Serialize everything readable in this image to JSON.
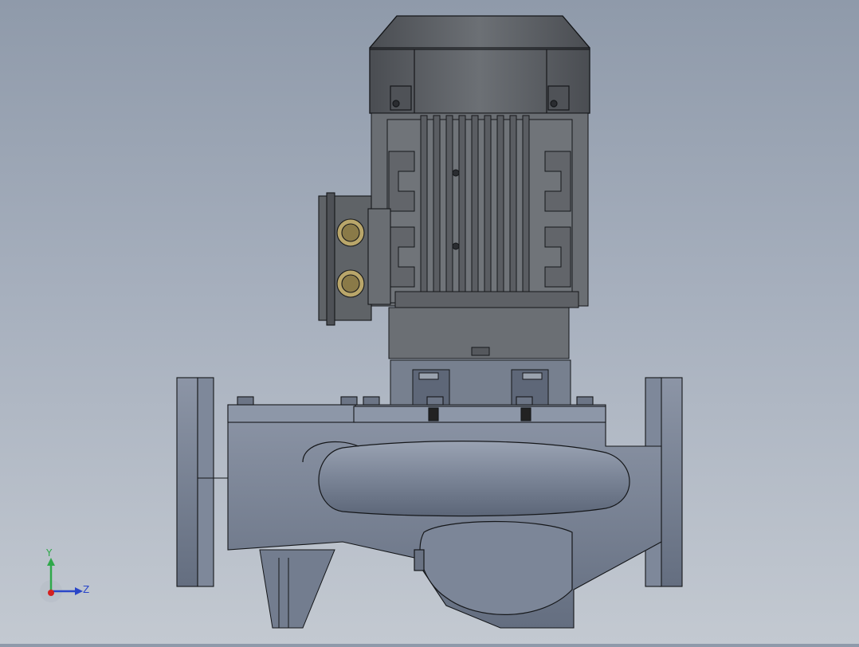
{
  "viewport": {
    "background_top": "#8f9aaa",
    "background_bottom": "#c3c9d1"
  },
  "model": {
    "parts": [
      "motor-fan-cover",
      "motor-body",
      "terminal-box",
      "motor-stool",
      "pump-casing",
      "inlet-flange",
      "outlet-flange",
      "volute",
      "base-foot"
    ],
    "colors": {
      "motor": "#5f6266",
      "motor_dark": "#3f4246",
      "casing": "#707a8c",
      "casing_light": "#8d97a8",
      "edge": "#1a1c20"
    }
  },
  "triad": {
    "y_label": "Y",
    "z_label": "Z",
    "y_color": "#2fa84a",
    "z_color": "#2a46c8",
    "x_color": "#d42020"
  }
}
